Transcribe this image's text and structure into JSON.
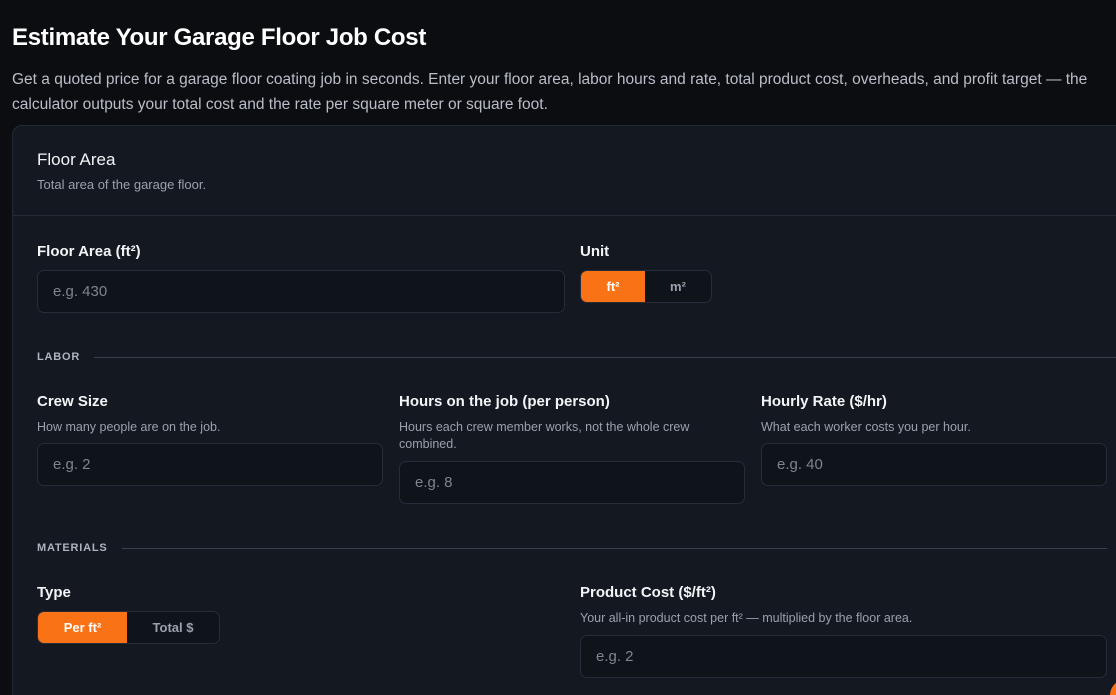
{
  "header": {
    "title": "Estimate Your Garage Floor Job Cost",
    "intro": "Get a quoted price for a garage floor coating job in seconds. Enter your floor area, labor hours and rate, total product cost, overheads, and profit target — the calculator outputs your total cost and the rate per square meter or square foot."
  },
  "floor_area": {
    "title": "Floor Area",
    "subtitle": "Total area of the garage floor.",
    "area_label": "Floor Area (ft²)",
    "area_placeholder": "e.g. 430",
    "unit_label": "Unit",
    "unit_options": [
      "ft²",
      "m²"
    ],
    "unit_selected": "ft²"
  },
  "labor": {
    "section_label": "LABOR",
    "crew_label": "Crew Size",
    "crew_help": "How many people are on the job.",
    "crew_placeholder": "e.g. 2",
    "hours_label": "Hours on the job (per person)",
    "hours_help": "Hours each crew member works, not the whole crew combined.",
    "hours_placeholder": "e.g. 8",
    "rate_label": "Hourly Rate ($/hr)",
    "rate_help": "What each worker costs you per hour.",
    "rate_placeholder": "e.g. 40"
  },
  "materials": {
    "section_label": "MATERIALS",
    "type_label": "Type",
    "type_options": [
      "Per ft²",
      "Total $"
    ],
    "type_selected": "Per ft²",
    "cost_label": "Product Cost ($/ft²)",
    "cost_help": "Your all-in product cost per ft² — multiplied by the floor area.",
    "cost_placeholder": "e.g. 2"
  },
  "colors": {
    "accent": "#f97316",
    "background": "#0b0d11",
    "card": "#131821",
    "input": "#0f131a"
  }
}
